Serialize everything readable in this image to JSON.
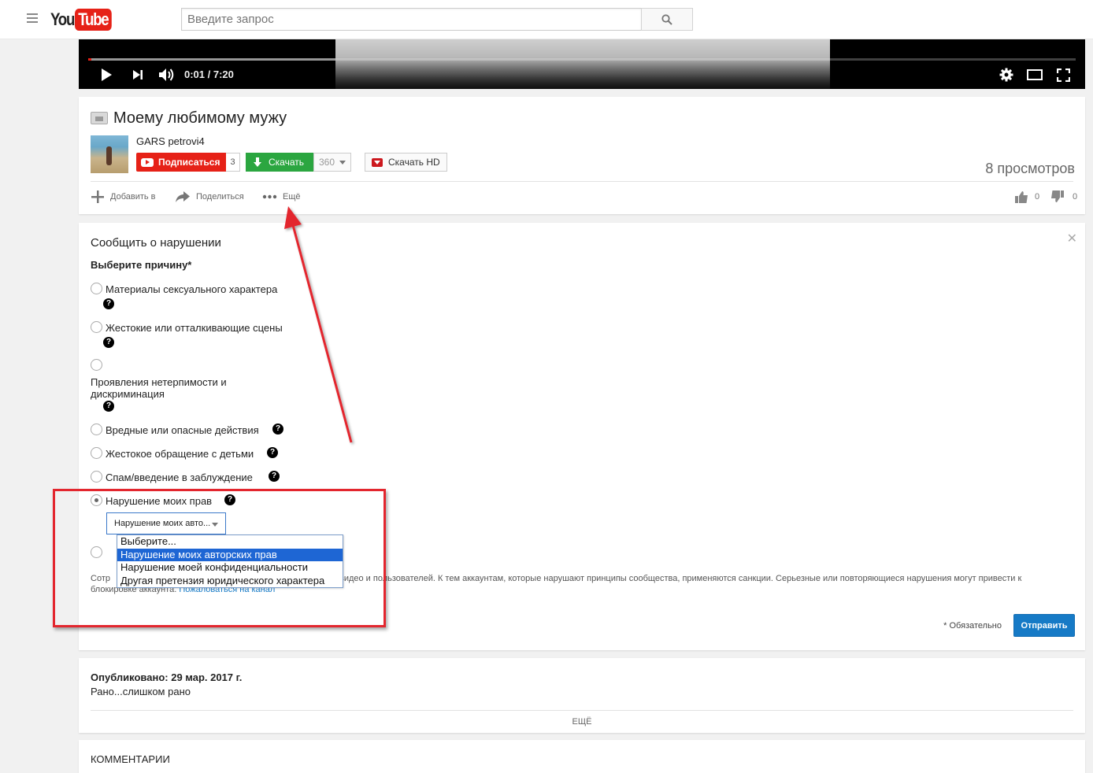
{
  "header": {
    "logo_you": "You",
    "logo_tube": "Tube",
    "search_placeholder": "Введите запрос"
  },
  "player": {
    "time": "0:01 / 7:20",
    "progress_played": 0.003,
    "progress_loaded": 0.25
  },
  "video": {
    "title": "Моему любимому мужу",
    "channel": "GARS petrovi4",
    "subscribe_label": "Подписаться",
    "subscriber_count": "3",
    "download_label": "Скачать",
    "download_quality": "360",
    "download_hd_label": "Скачать HD",
    "views": "8 просмотров",
    "actions": {
      "add": "Добавить в",
      "share": "Поделиться",
      "more": "Ещё"
    },
    "likes": "0",
    "dislikes": "0"
  },
  "report": {
    "title": "Сообщить о нарушении",
    "subtitle": "Выберите причину*",
    "reasons": [
      "Материалы сексуального характера",
      "Жестокие или отталкивающие сцены",
      "Проявления нетерпимости и дискриминация",
      "Вредные или опасные действия",
      "Жестокое обращение с детьми",
      "Спам/введение в заблуждение",
      "Нарушение моих прав"
    ],
    "help_glyph": "?",
    "selected_reason_index": 6,
    "select_value": "Нарушение моих авто...",
    "dropdown_options": [
      "Выберите...",
      "Нарушение моих авторских прав",
      "Нарушение моей конфиденциальности",
      "Другая претензия юридического характера"
    ],
    "dropdown_highlighted_index": 1,
    "note_part1": "Сотр",
    "note_part2": "видео и пользователей. К тем аккаунтам, которые нарушают принципы сообщества, применяются санкции. Серьезные или повторяющиеся нарушения могут привести к",
    "note_line2_prefix": "блокировке аккаунта.",
    "note_link": "Пожаловаться на канал",
    "required_note": "* Обязательно",
    "submit_label": "Отправить"
  },
  "description": {
    "published": "Опубликовано: 29 мар. 2017 г.",
    "text": "Рано...слишком рано",
    "more_label": "ЕЩЁ"
  },
  "comments": {
    "title": "КОММЕНТАРИИ"
  },
  "colors": {
    "brand_red": "#e62117",
    "download_green": "#2ba640",
    "link_blue": "#167ac6",
    "annotation_red": "#e3262e",
    "dropdown_highlight": "#1e66d4"
  }
}
